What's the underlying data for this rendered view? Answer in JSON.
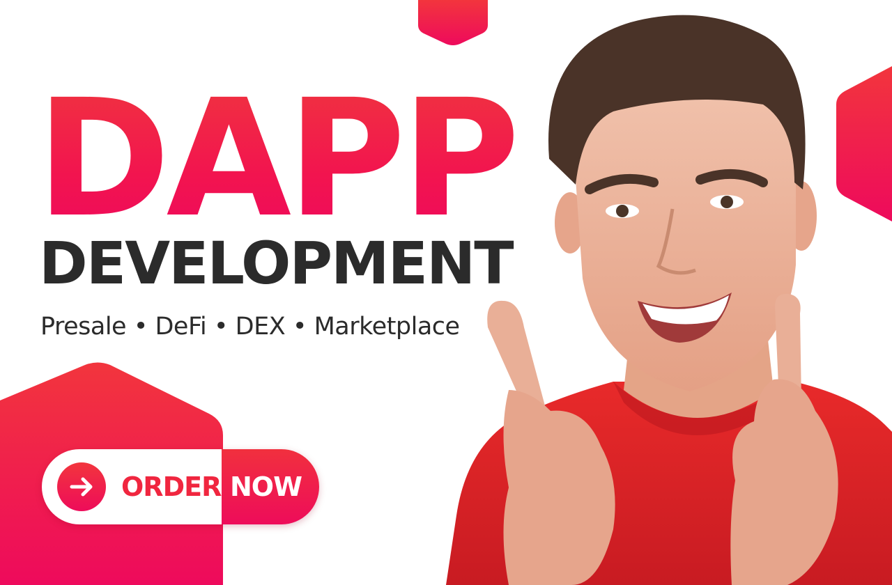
{
  "headline": {
    "title": "DAPP",
    "subtitle": "DEVELOPMENT",
    "services": "Presale • DeFi • DEX • Marketplace"
  },
  "cta": {
    "word_1": "ORDER",
    "word_2": "NOW"
  },
  "colors": {
    "brand_red": "#f0263f",
    "brand_pink": "#ee0a5c",
    "text_dark": "#2b2b2b",
    "background": "#ffffff"
  },
  "icons": {
    "cta_icon": "arrow-right-icon"
  }
}
